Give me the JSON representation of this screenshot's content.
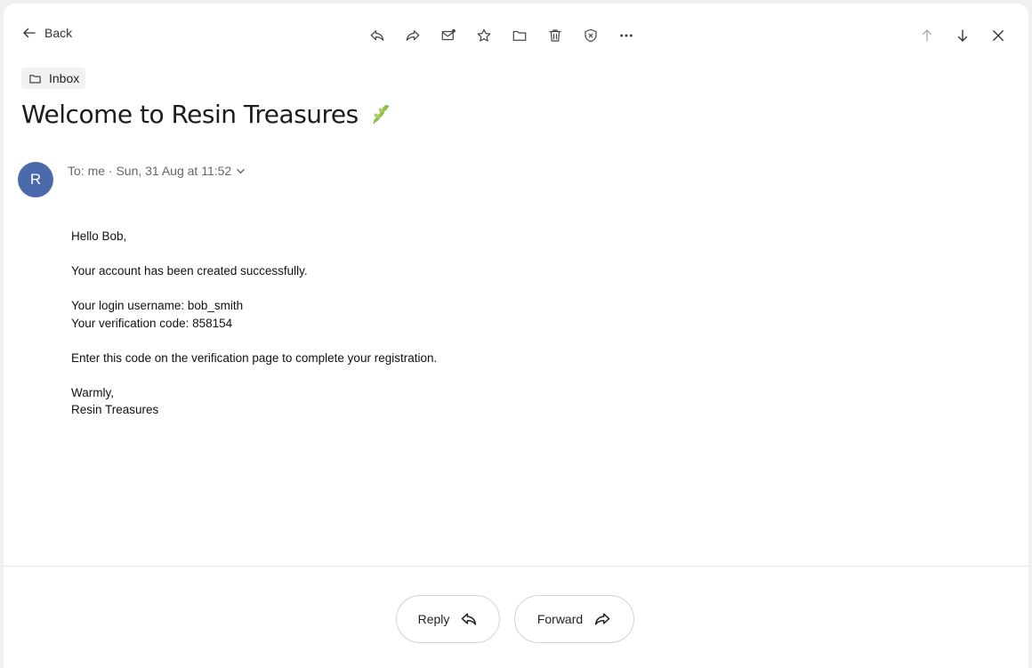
{
  "toolbar": {
    "back_label": "Back",
    "actions": [
      {
        "icon": "reply-icon"
      },
      {
        "icon": "forward-icon"
      },
      {
        "icon": "mark-unread-icon"
      },
      {
        "icon": "star-icon"
      },
      {
        "icon": "folder-icon"
      },
      {
        "icon": "trash-icon"
      },
      {
        "icon": "spam-shield-icon"
      },
      {
        "icon": "more-icon"
      }
    ],
    "nav": [
      {
        "icon": "arrow-up-icon"
      },
      {
        "icon": "arrow-down-icon"
      },
      {
        "icon": "close-icon"
      }
    ]
  },
  "email": {
    "folder": "Inbox",
    "subject": "Welcome to Resin Treasures",
    "sender_initial": "R",
    "meta": "To:  me · Sun, 31 Aug at 11:52",
    "avatar_color": "#4a6aab",
    "body": {
      "greeting": "Hello Bob,",
      "line1": "Your account has been created successfully.",
      "username_line": "Your login username: bob_smith",
      "code_line": "Your verification code: 858154",
      "instruction": "Enter this code on the verification page to complete your registration.",
      "signoff": "Warmly,",
      "signature": "Resin Treasures"
    }
  },
  "footer": {
    "reply_label": "Reply",
    "forward_label": "Forward"
  }
}
